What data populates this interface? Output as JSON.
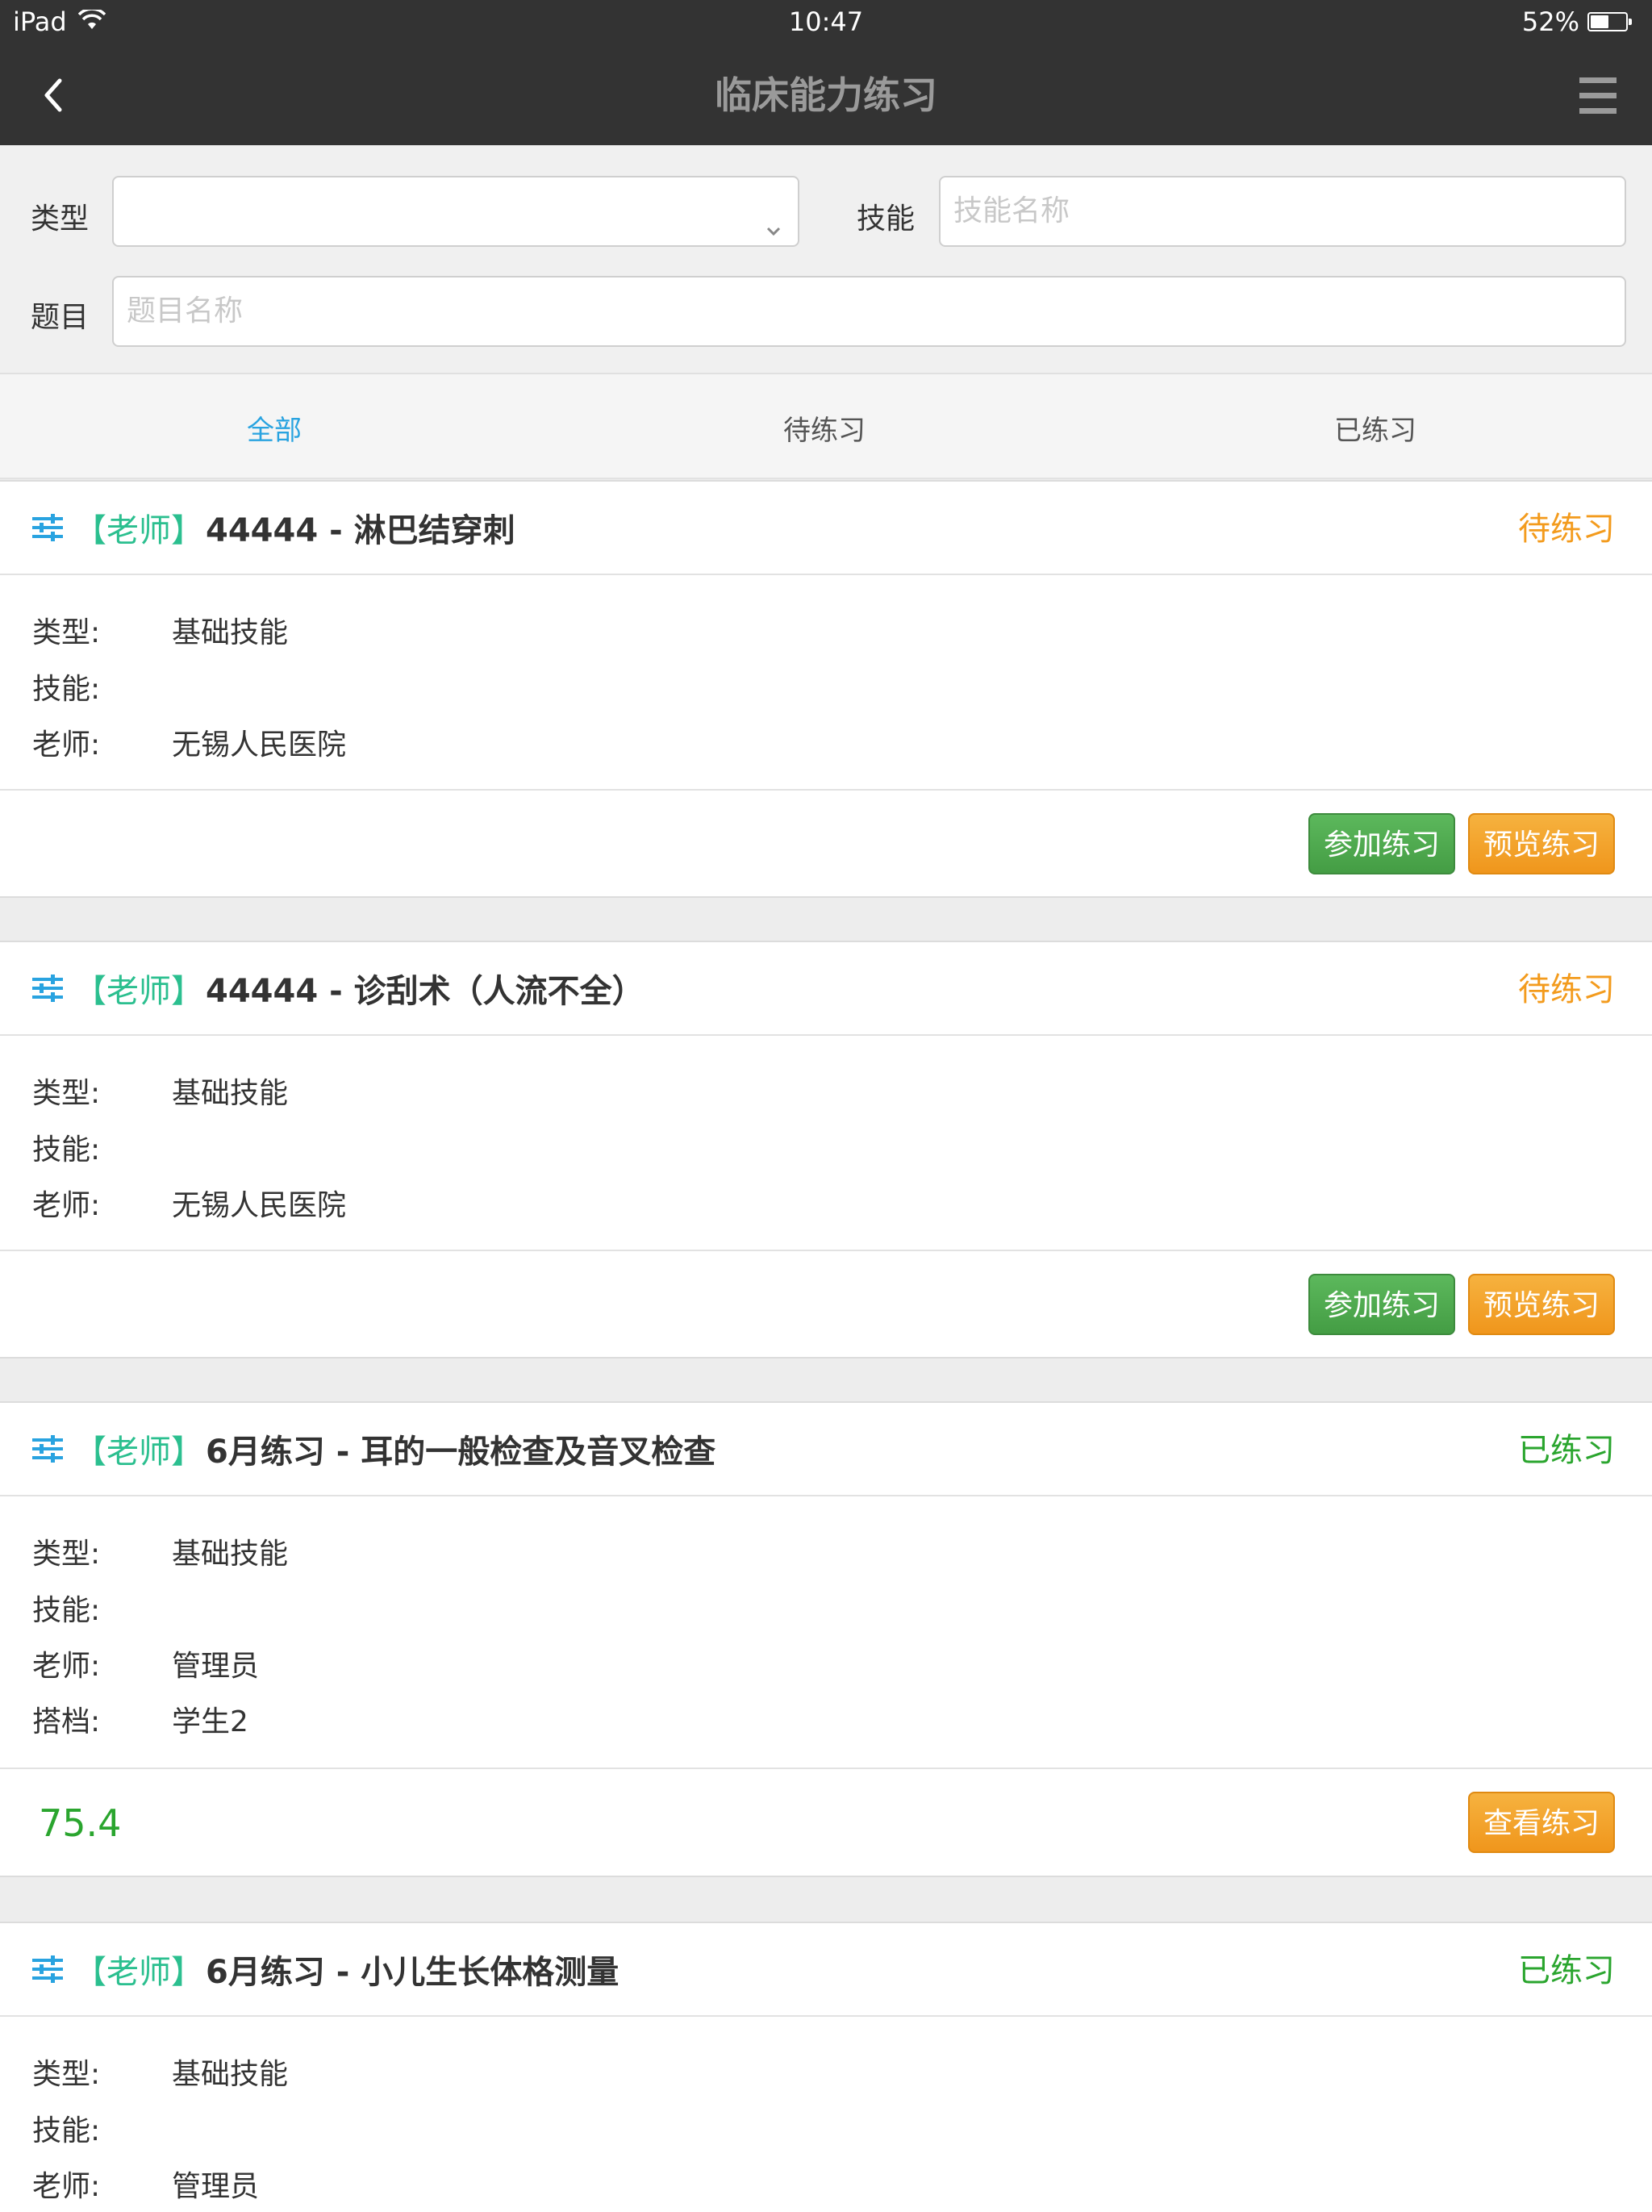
{
  "status_bar": {
    "device": "iPad",
    "time": "10:47",
    "battery": "52%",
    "battery_level": 0.52
  },
  "nav": {
    "title": "临床能力练习"
  },
  "filters": {
    "type_label": "类型",
    "type_value": "",
    "skill_label": "技能",
    "skill_placeholder": "技能名称",
    "topic_label": "题目",
    "topic_placeholder": "题目名称"
  },
  "tabs": [
    {
      "label": "全部",
      "active": true
    },
    {
      "label": "待练习",
      "active": false
    },
    {
      "label": "已练习",
      "active": false
    }
  ],
  "colors": {
    "active_tab": "#29a3e0",
    "teacher_tag": "#2bbf8f",
    "pending": "#f39b1d",
    "done": "#2aa52e",
    "button_green": "#4cae4c",
    "button_orange": "#f0a02a"
  },
  "field_labels": {
    "type": "类型:",
    "skill": "技能:",
    "teacher": "老师:",
    "partner": "搭档:"
  },
  "cards": [
    {
      "tag": "【老师】",
      "name": "44444 - 淋巴结穿刺",
      "status": "待练习",
      "type": "基础技能",
      "skill": "",
      "teacher": "无锡人民医院",
      "buttons": [
        "参加练习",
        "预览练习"
      ]
    },
    {
      "tag": "【老师】",
      "name": "44444 - 诊刮术（人流不全）",
      "status": "待练习",
      "type": "基础技能",
      "skill": "",
      "teacher": "无锡人民医院",
      "buttons": [
        "参加练习",
        "预览练习"
      ]
    },
    {
      "tag": "【老师】",
      "name": "6月练习 - 耳的一般检查及音叉检查",
      "status": "已练习",
      "type": "基础技能",
      "skill": "",
      "teacher": "管理员",
      "partner": "学生2",
      "score": "75.4",
      "buttons": [
        "查看练习"
      ]
    },
    {
      "tag": "【老师】",
      "name": "6月练习 - 小儿生长体格测量",
      "status": "已练习",
      "type": "基础技能",
      "skill": "",
      "teacher": "管理员"
    }
  ]
}
